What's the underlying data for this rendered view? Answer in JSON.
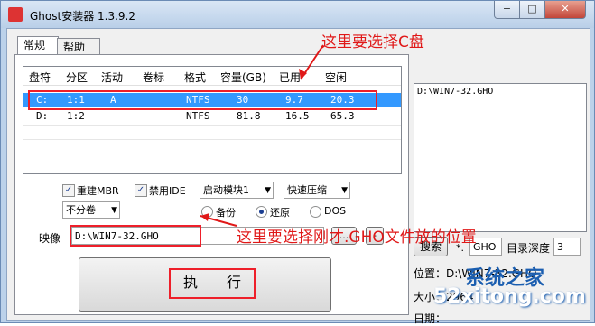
{
  "window": {
    "title": "Ghost安装器 1.3.9.2",
    "min": "−",
    "max": "□",
    "close": "✕"
  },
  "tabs": [
    "常规",
    "帮助"
  ],
  "partition_table": {
    "headers": [
      "盘符",
      "分区",
      "活动",
      "卷标",
      "格式",
      "容量(GB)",
      "已用",
      "空闲"
    ],
    "rows": [
      [
        "C:",
        "1:1",
        "A",
        "",
        "NTFS",
        "30",
        "9.7",
        "20.3"
      ],
      [
        "D:",
        "1:2",
        "",
        "",
        "NTFS",
        "81.8",
        "16.5",
        "65.3"
      ]
    ]
  },
  "options": {
    "rebuild_mbr": {
      "label": "重建MBR",
      "checked": true
    },
    "disable_ide": {
      "label": "禁用IDE",
      "checked": true
    },
    "boot_module": "启动模块1",
    "compression": "快速压缩",
    "split": "不分卷",
    "radios": [
      {
        "label": "备份",
        "selected": false
      },
      {
        "label": "还原",
        "selected": true
      },
      {
        "label": "DOS",
        "selected": false
      }
    ]
  },
  "image": {
    "label": "映像",
    "path": "D:\\WIN7-32.GHO",
    "browse": "...",
    "remove": "-"
  },
  "execute": {
    "label": "执　　行"
  },
  "file_list": [
    "D:\\WIN7-32.GHO"
  ],
  "search": {
    "button": "搜索",
    "ext_prefix": "*.",
    "ext": "GHO",
    "depth_label": "目录深度",
    "depth": "3"
  },
  "info": {
    "position": "位置：D:\\WIN7-32.GHO",
    "size": "大小：2964",
    "date": "日期："
  },
  "annotations": {
    "top": "这里要选择C盘",
    "bottom": "这里要选择刚才.GHO文件放的位置"
  },
  "watermark": {
    "line1": "系统之家",
    "line2": "52xitong.com"
  }
}
